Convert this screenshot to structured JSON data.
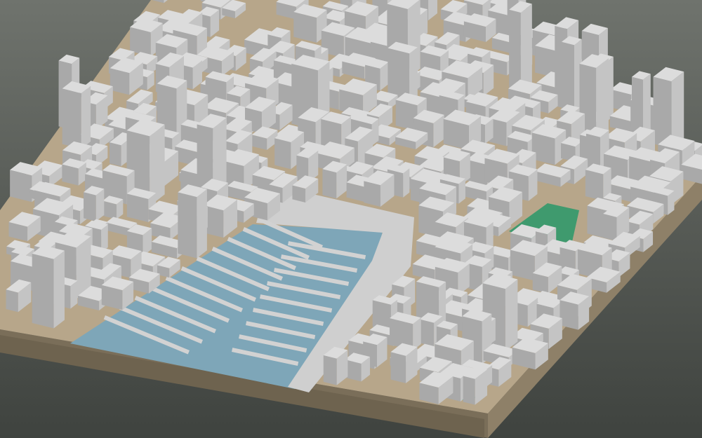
{
  "scene": {
    "background_top": "#6f736d",
    "background_bottom": "#3f433f",
    "ground_color": "#b7a68a",
    "base_side_color": "#8e8068",
    "base_front_color": "#7a6e59",
    "building_top": "#dcdcdc",
    "building_side_left": "#a9a9a9",
    "building_side_right": "#c4c4c4",
    "water_color": "#7ea6b8",
    "pier_color": "#d2d2d2",
    "park_color": "#3f9a6e",
    "quay_color": "#cfcfcf"
  }
}
